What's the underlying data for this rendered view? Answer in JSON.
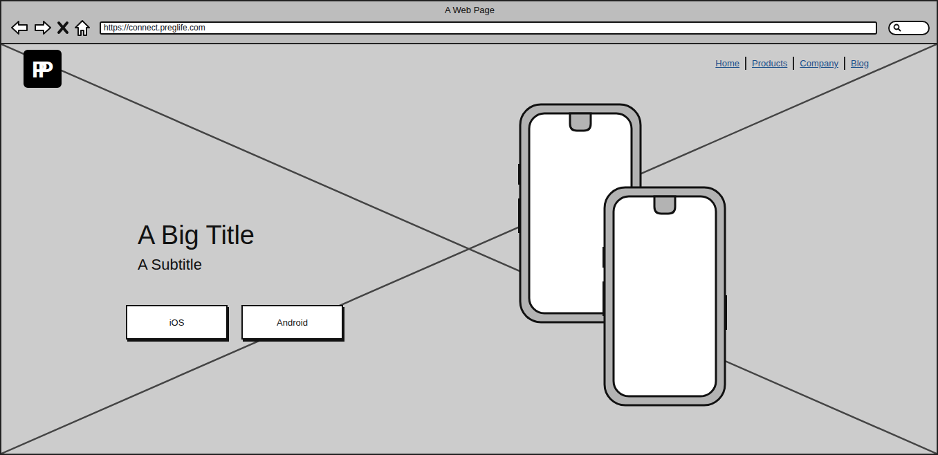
{
  "window": {
    "title": "A Web Page"
  },
  "address_bar": {
    "url": "https://connect.preglife.com"
  },
  "logo": {
    "text": "PP"
  },
  "nav": {
    "items": [
      "Home",
      "Products",
      "Company",
      "Blog"
    ]
  },
  "hero": {
    "title": "A Big Title",
    "subtitle": "A Subtitle",
    "buttons": [
      "iOS",
      "Android"
    ]
  }
}
